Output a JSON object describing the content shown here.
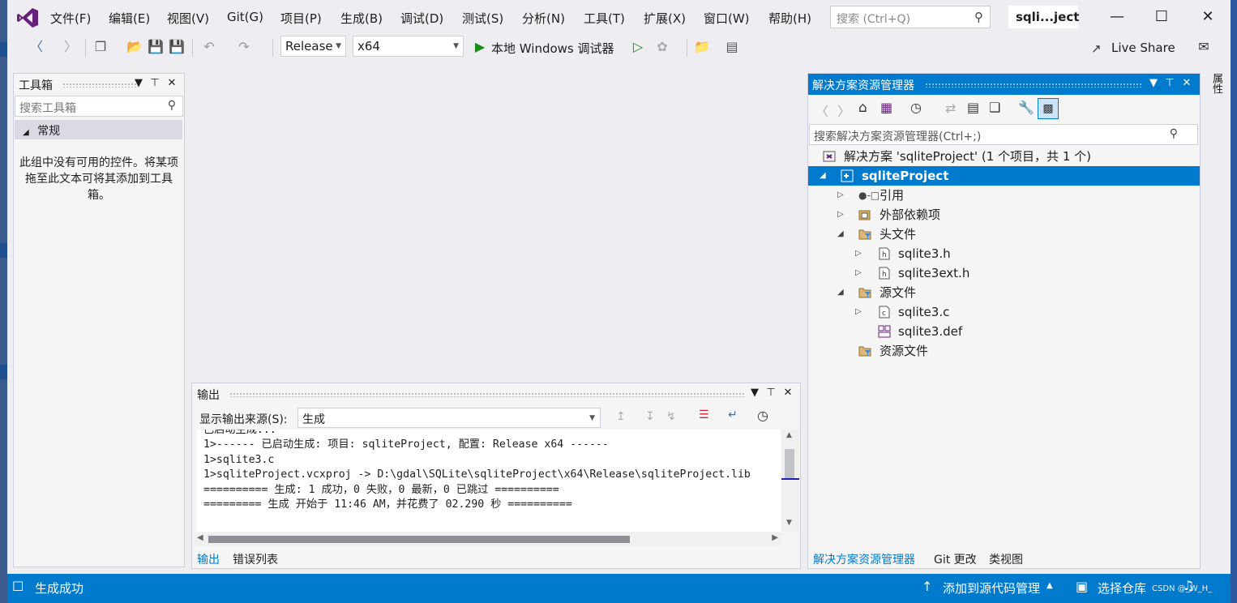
{
  "menu": {
    "items": [
      "文件(F)",
      "编辑(E)",
      "视图(V)",
      "Git(G)",
      "项目(P)",
      "生成(B)",
      "调试(D)",
      "测试(S)",
      "分析(N)",
      "工具(T)",
      "扩展(X)",
      "窗口(W)",
      "帮助(H)"
    ],
    "search_placeholder": "搜索 (Ctrl+Q)",
    "title": "sqli...ject"
  },
  "toolbar": {
    "configuration": "Release",
    "platform": "x64",
    "run_label": "本地 Windows 调试器",
    "liveshare": "Live Share"
  },
  "toolbox": {
    "title": "工具箱",
    "search_placeholder": "搜索工具箱",
    "group": "常规",
    "empty_text": "此组中没有可用的控件。将某项拖至此文本可将其添加到工具箱。"
  },
  "output": {
    "title": "输出",
    "source_label": "显示输出来源(S):",
    "source_value": "生成",
    "lines": [
      "已启动生成...",
      "1>------ 已启动生成: 项目: sqliteProject, 配置: Release x64 ------",
      "1>sqlite3.c",
      "1>sqliteProject.vcxproj -> D:\\gdal\\SQLite\\sqliteProject\\x64\\Release\\sqliteProject.lib",
      "========== 生成: 1 成功，0 失败，0 最新，0 已跳过 ==========",
      "========= 生成 开始于 11:46 AM，并花费了 02.290 秒 =========="
    ],
    "tabs": [
      "输出",
      "错误列表"
    ]
  },
  "solution_explorer": {
    "title": "解决方案资源管理器",
    "search_placeholder": "搜索解决方案资源管理器(Ctrl+;)",
    "solution_label": "解决方案 'sqliteProject' (1 个项目，共 1 个)",
    "project": "sqliteProject",
    "nodes": [
      "引用",
      "外部依赖项",
      "头文件",
      "sqlite3.h",
      "sqlite3ext.h",
      "源文件",
      "sqlite3.c",
      "sqlite3.def",
      "资源文件"
    ],
    "tabs": [
      "解决方案资源管理器",
      "Git 更改",
      "类视图"
    ]
  },
  "properties_label": "属性",
  "status": {
    "left": "生成成功",
    "add_source": "添加到源代码管理",
    "select_repo": "选择仓库",
    "watermark": "CSDN @_W_H_"
  },
  "colors": {
    "accent": "#007acc",
    "vs_purple": "#68217a"
  }
}
